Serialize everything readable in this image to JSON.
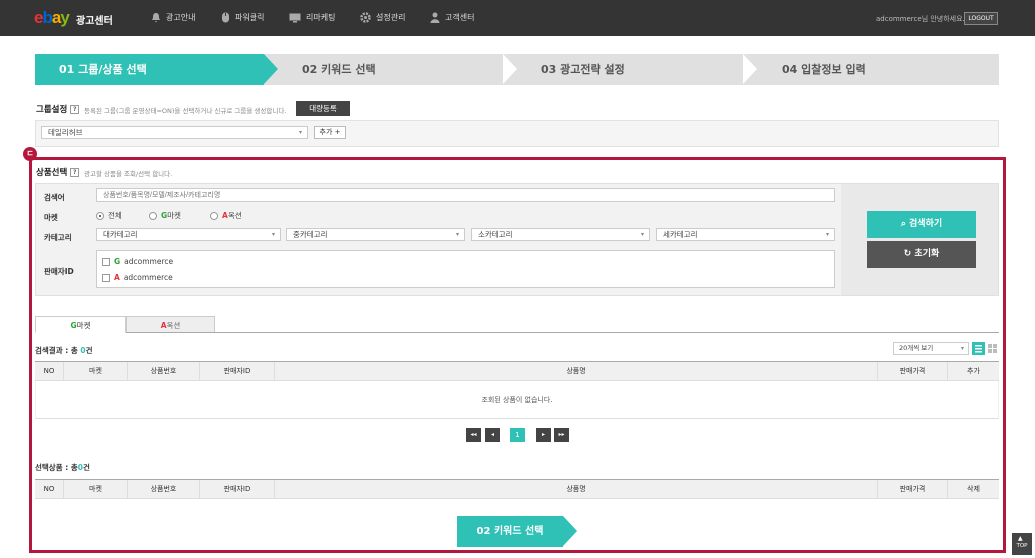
{
  "header": {
    "logo_e": "e",
    "logo_b": "b",
    "logo_a": "a",
    "logo_y": "y",
    "title": "광고센터",
    "nav": [
      {
        "label": "광고안내",
        "icon": "bell-icon"
      },
      {
        "label": "파워클릭",
        "icon": "mouse-icon"
      },
      {
        "label": "리마케팅",
        "icon": "monitor-icon"
      },
      {
        "label": "설정관리",
        "icon": "gear-icon"
      },
      {
        "label": "고객센터",
        "icon": "person-icon"
      }
    ],
    "user_text": "adcommerce님 안녕하세요.",
    "logout": "LOGOUT"
  },
  "steps": [
    {
      "label": "01 그룹/상품 선택",
      "active": true
    },
    {
      "label": "02 키워드 선택",
      "active": false
    },
    {
      "label": "03 광고전략 설정",
      "active": false
    },
    {
      "label": "04 입찰정보 입력",
      "active": false
    }
  ],
  "group": {
    "title": "그룹설정",
    "help": "?",
    "hint": "등록된 그룹(그룹 운영상태=ON)을 선택하거나 신규로 그룹을 생성합니다.",
    "register_btn": "대량등록",
    "selected": "데일리허브",
    "add_btn": "추가 +"
  },
  "badge": "ㄷ",
  "product": {
    "title": "상품선택",
    "help": "?",
    "hint": "광고할 상품을 조회/선택 합니다.",
    "search_label": "검색어",
    "search_placeholder": "상품번호/품목명/모델/제조사/카테고리명",
    "market_label": "마켓",
    "markets": [
      {
        "prefix": "",
        "label": "전체",
        "checked": true
      },
      {
        "prefix": "G",
        "label": "마켓",
        "checked": false
      },
      {
        "prefix": "A",
        "label": "옥션",
        "checked": false
      }
    ],
    "category_label": "카테고리",
    "categories": [
      "대카테고리",
      "중카테고리",
      "소카테고리",
      "세카테고리"
    ],
    "seller_label": "판매자ID",
    "sellers": [
      {
        "prefix": "G",
        "id": "adcommerce"
      },
      {
        "prefix": "A",
        "id": "adcommerce"
      }
    ],
    "search_btn": "검색하기",
    "reset_btn": "초기화"
  },
  "tabs": [
    {
      "prefix": "G",
      "label": "마켓"
    },
    {
      "prefix": "A",
      "label": "옥션"
    }
  ],
  "results": {
    "label_prefix": "검색결과 : 총 ",
    "count": "0",
    "label_suffix": "건",
    "view_option": "20개씩 보기",
    "columns": [
      "NO",
      "마켓",
      "상품번호",
      "판매자ID",
      "상품명",
      "판매가격",
      "추가"
    ],
    "empty_msg": "조회된 상품이 없습니다."
  },
  "pagination": {
    "first": "◂◂",
    "prev": "◂",
    "current": "1",
    "next": "▸",
    "last": "▸▸"
  },
  "selected": {
    "label_prefix": "선택상품 : 총",
    "count": "0",
    "label_suffix": "건",
    "columns": [
      "NO",
      "마켓",
      "상품번호",
      "판매자ID",
      "상품명",
      "판매가격",
      "삭제"
    ]
  },
  "next_btn": "02 키워드 선택",
  "top_btn": "TOP",
  "colors": {
    "accent": "#2fc1b5",
    "highlight": "#b5163c",
    "header": "#343434"
  }
}
